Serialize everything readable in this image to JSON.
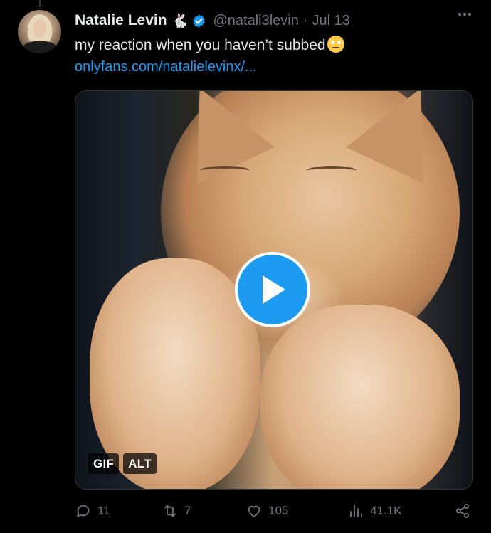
{
  "tweet": {
    "author_name": "Natalie Levin",
    "author_emoji": "🐇",
    "handle": "@natali3levin",
    "separator": "·",
    "date": "Jul 13",
    "text": "my reaction when you haven’t subbed",
    "link": "onlyfans.com/natalielevinx/...",
    "emoji_icon": "face-with-rolling-eyes-icon"
  },
  "media": {
    "badges": [
      "GIF",
      "ALT"
    ]
  },
  "actions": {
    "replies": "11",
    "retweets": "7",
    "likes": "105",
    "views": "41.1K"
  },
  "colors": {
    "background": "#000000",
    "text": "#e7e9ea",
    "muted": "#71767b",
    "accent": "#1d9bf0"
  }
}
